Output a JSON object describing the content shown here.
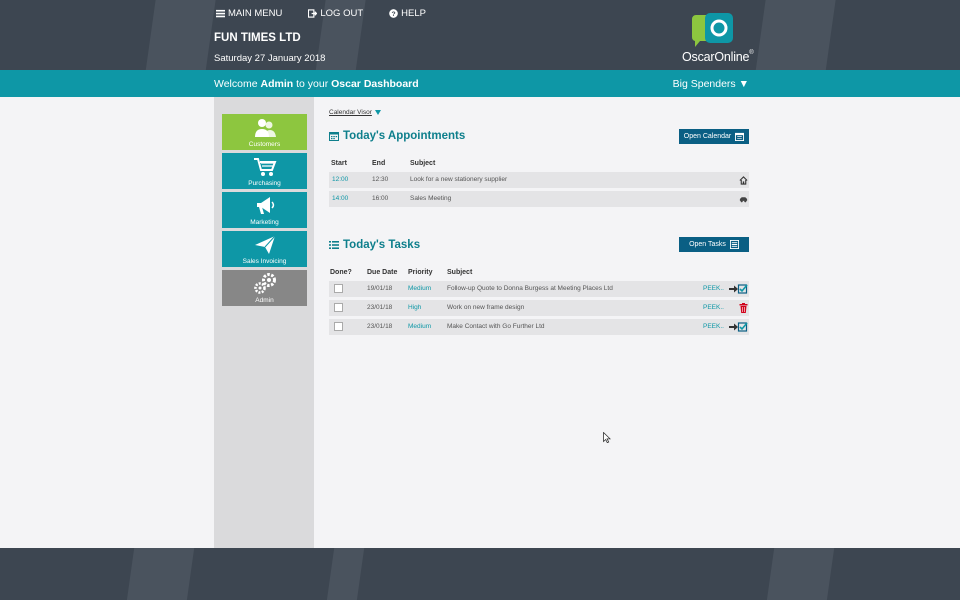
{
  "header": {
    "nav": [
      {
        "label": "MAIN MENU",
        "icon": "menu-icon"
      },
      {
        "label": "LOG OUT",
        "icon": "logout-icon"
      },
      {
        "label": "HELP",
        "icon": "help-icon"
      }
    ],
    "company": "FUN TIMES LTD",
    "date": "Saturday 27 January 2018",
    "logo_text": "OscarOnline",
    "logo_mark": "®"
  },
  "welcome_bar": {
    "welcome_prefix": "Welcome",
    "user": "Admin",
    "welcome_mid": "to your",
    "app": "Oscar",
    "dashboard": "Dashboard",
    "view_selector": "Big Spenders ▼"
  },
  "sidebar": {
    "tiles": [
      {
        "label": "Customers",
        "icon": "customers-icon"
      },
      {
        "label": "Purchasing",
        "icon": "shopping-cart-icon"
      },
      {
        "label": "Marketing",
        "icon": "megaphone-icon"
      },
      {
        "label": "Sales Invoicing",
        "icon": "paper-plane-icon"
      },
      {
        "label": "Admin",
        "icon": "gears-icon"
      }
    ]
  },
  "calendar_visor": "Calendar Visor",
  "appointments": {
    "title": "Today's Appointments",
    "button": "Open Calendar",
    "columns": [
      "Start",
      "End",
      "Subject"
    ],
    "rows": [
      {
        "start": "12:00",
        "end": "12:30",
        "subject": "Look for a new stationery supplier",
        "icon": "home-icon"
      },
      {
        "start": "14:00",
        "end": "16:00",
        "subject": "Sales Meeting",
        "icon": "car-icon"
      }
    ]
  },
  "tasks": {
    "title": "Today's Tasks",
    "button": "Open Tasks",
    "columns": [
      "Done?",
      "Due Date",
      "Priority",
      "Subject"
    ],
    "rows": [
      {
        "due": "19/01/18",
        "priority": "Medium",
        "subject": "Follow-up Quote to Donna Burgess at Meeting Places Ltd",
        "peek": "PEEK..",
        "icon": "forward-check-icon"
      },
      {
        "due": "23/01/18",
        "priority": "High",
        "subject": "Work on new frame design",
        "peek": "PEEK..",
        "icon": "trash-icon"
      },
      {
        "due": "23/01/18",
        "priority": "Medium",
        "subject": "Make Contact with Go Further Ltd",
        "peek": "PEEK..",
        "icon": "forward-check-icon"
      }
    ]
  },
  "colors": {
    "header_bg": "#3d4651",
    "teal": "#0e97a6",
    "button_blue": "#0a5f84",
    "customers_green": "#8dc63f",
    "admin_grey": "#878787"
  }
}
